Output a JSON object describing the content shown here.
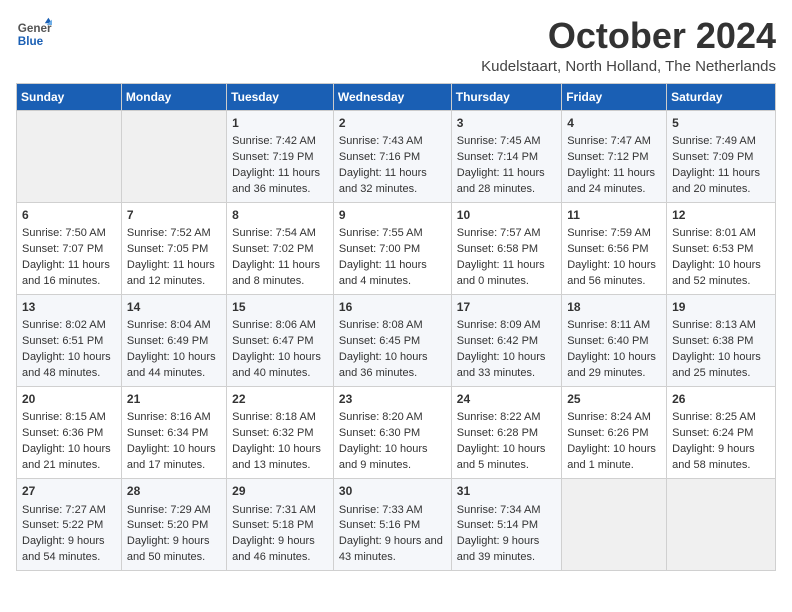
{
  "header": {
    "logo_line1": "General",
    "logo_line2": "Blue",
    "month": "October 2024",
    "location": "Kudelstaart, North Holland, The Netherlands"
  },
  "days_of_week": [
    "Sunday",
    "Monday",
    "Tuesday",
    "Wednesday",
    "Thursday",
    "Friday",
    "Saturday"
  ],
  "weeks": [
    [
      {
        "day": "",
        "content": ""
      },
      {
        "day": "",
        "content": ""
      },
      {
        "day": "1",
        "content": "Sunrise: 7:42 AM\nSunset: 7:19 PM\nDaylight: 11 hours and 36 minutes."
      },
      {
        "day": "2",
        "content": "Sunrise: 7:43 AM\nSunset: 7:16 PM\nDaylight: 11 hours and 32 minutes."
      },
      {
        "day": "3",
        "content": "Sunrise: 7:45 AM\nSunset: 7:14 PM\nDaylight: 11 hours and 28 minutes."
      },
      {
        "day": "4",
        "content": "Sunrise: 7:47 AM\nSunset: 7:12 PM\nDaylight: 11 hours and 24 minutes."
      },
      {
        "day": "5",
        "content": "Sunrise: 7:49 AM\nSunset: 7:09 PM\nDaylight: 11 hours and 20 minutes."
      }
    ],
    [
      {
        "day": "6",
        "content": "Sunrise: 7:50 AM\nSunset: 7:07 PM\nDaylight: 11 hours and 16 minutes."
      },
      {
        "day": "7",
        "content": "Sunrise: 7:52 AM\nSunset: 7:05 PM\nDaylight: 11 hours and 12 minutes."
      },
      {
        "day": "8",
        "content": "Sunrise: 7:54 AM\nSunset: 7:02 PM\nDaylight: 11 hours and 8 minutes."
      },
      {
        "day": "9",
        "content": "Sunrise: 7:55 AM\nSunset: 7:00 PM\nDaylight: 11 hours and 4 minutes."
      },
      {
        "day": "10",
        "content": "Sunrise: 7:57 AM\nSunset: 6:58 PM\nDaylight: 11 hours and 0 minutes."
      },
      {
        "day": "11",
        "content": "Sunrise: 7:59 AM\nSunset: 6:56 PM\nDaylight: 10 hours and 56 minutes."
      },
      {
        "day": "12",
        "content": "Sunrise: 8:01 AM\nSunset: 6:53 PM\nDaylight: 10 hours and 52 minutes."
      }
    ],
    [
      {
        "day": "13",
        "content": "Sunrise: 8:02 AM\nSunset: 6:51 PM\nDaylight: 10 hours and 48 minutes."
      },
      {
        "day": "14",
        "content": "Sunrise: 8:04 AM\nSunset: 6:49 PM\nDaylight: 10 hours and 44 minutes."
      },
      {
        "day": "15",
        "content": "Sunrise: 8:06 AM\nSunset: 6:47 PM\nDaylight: 10 hours and 40 minutes."
      },
      {
        "day": "16",
        "content": "Sunrise: 8:08 AM\nSunset: 6:45 PM\nDaylight: 10 hours and 36 minutes."
      },
      {
        "day": "17",
        "content": "Sunrise: 8:09 AM\nSunset: 6:42 PM\nDaylight: 10 hours and 33 minutes."
      },
      {
        "day": "18",
        "content": "Sunrise: 8:11 AM\nSunset: 6:40 PM\nDaylight: 10 hours and 29 minutes."
      },
      {
        "day": "19",
        "content": "Sunrise: 8:13 AM\nSunset: 6:38 PM\nDaylight: 10 hours and 25 minutes."
      }
    ],
    [
      {
        "day": "20",
        "content": "Sunrise: 8:15 AM\nSunset: 6:36 PM\nDaylight: 10 hours and 21 minutes."
      },
      {
        "day": "21",
        "content": "Sunrise: 8:16 AM\nSunset: 6:34 PM\nDaylight: 10 hours and 17 minutes."
      },
      {
        "day": "22",
        "content": "Sunrise: 8:18 AM\nSunset: 6:32 PM\nDaylight: 10 hours and 13 minutes."
      },
      {
        "day": "23",
        "content": "Sunrise: 8:20 AM\nSunset: 6:30 PM\nDaylight: 10 hours and 9 minutes."
      },
      {
        "day": "24",
        "content": "Sunrise: 8:22 AM\nSunset: 6:28 PM\nDaylight: 10 hours and 5 minutes."
      },
      {
        "day": "25",
        "content": "Sunrise: 8:24 AM\nSunset: 6:26 PM\nDaylight: 10 hours and 1 minute."
      },
      {
        "day": "26",
        "content": "Sunrise: 8:25 AM\nSunset: 6:24 PM\nDaylight: 9 hours and 58 minutes."
      }
    ],
    [
      {
        "day": "27",
        "content": "Sunrise: 7:27 AM\nSunset: 5:22 PM\nDaylight: 9 hours and 54 minutes."
      },
      {
        "day": "28",
        "content": "Sunrise: 7:29 AM\nSunset: 5:20 PM\nDaylight: 9 hours and 50 minutes."
      },
      {
        "day": "29",
        "content": "Sunrise: 7:31 AM\nSunset: 5:18 PM\nDaylight: 9 hours and 46 minutes."
      },
      {
        "day": "30",
        "content": "Sunrise: 7:33 AM\nSunset: 5:16 PM\nDaylight: 9 hours and 43 minutes."
      },
      {
        "day": "31",
        "content": "Sunrise: 7:34 AM\nSunset: 5:14 PM\nDaylight: 9 hours and 39 minutes."
      },
      {
        "day": "",
        "content": ""
      },
      {
        "day": "",
        "content": ""
      }
    ]
  ]
}
